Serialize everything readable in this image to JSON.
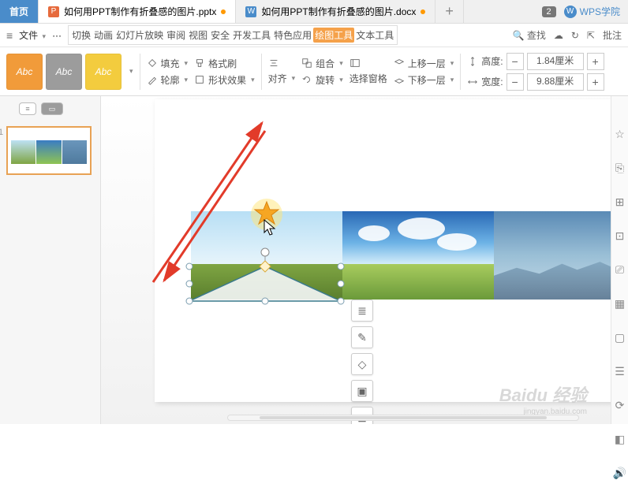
{
  "tabs": {
    "home": "首页",
    "file1": "如何用PPT制作有折叠感的图片.pptx",
    "file2": "如何用PPT制作有折叠感的图片.docx"
  },
  "topRight": {
    "badge": "2",
    "college": "WPS学院"
  },
  "menubar": {
    "file": "文件",
    "items": {
      "switch": "切换",
      "anim": "动画",
      "slideshow": "幻灯片放映",
      "review": "审阅",
      "view": "视图",
      "security": "安全",
      "devtools": "开发工具",
      "featured": "特色应用",
      "drawtools": "绘图工具",
      "texttools": "文本工具"
    },
    "search": "查找",
    "annotate": "批注"
  },
  "ribbon": {
    "abc": "Abc",
    "fill": "填充",
    "formatBrush": "格式刷",
    "outline": "轮廓",
    "shapeEffect": "形状效果",
    "align": "对齐",
    "group": "组合",
    "rotate": "旋转",
    "selectPane": "选择窗格",
    "moveUp": "上移一层",
    "moveDown": "下移一层",
    "height": "高度:",
    "width": "宽度:",
    "heightVal": "1.84厘米",
    "widthVal": "9.88厘米"
  },
  "slide": {
    "num": "1"
  },
  "float": {
    "layers": "≣",
    "brush": "✎",
    "shape": "◇",
    "crop": "▣",
    "grid": "⊞"
  },
  "railIcons": [
    "☆",
    "⎘",
    "⊞",
    "⊡",
    "⎚",
    "▦",
    "▢",
    "☰",
    "⟳",
    "◧",
    "🔊"
  ],
  "watermark": {
    "main": "Baidu 经验",
    "sub": "jingyan.baidu.com"
  }
}
